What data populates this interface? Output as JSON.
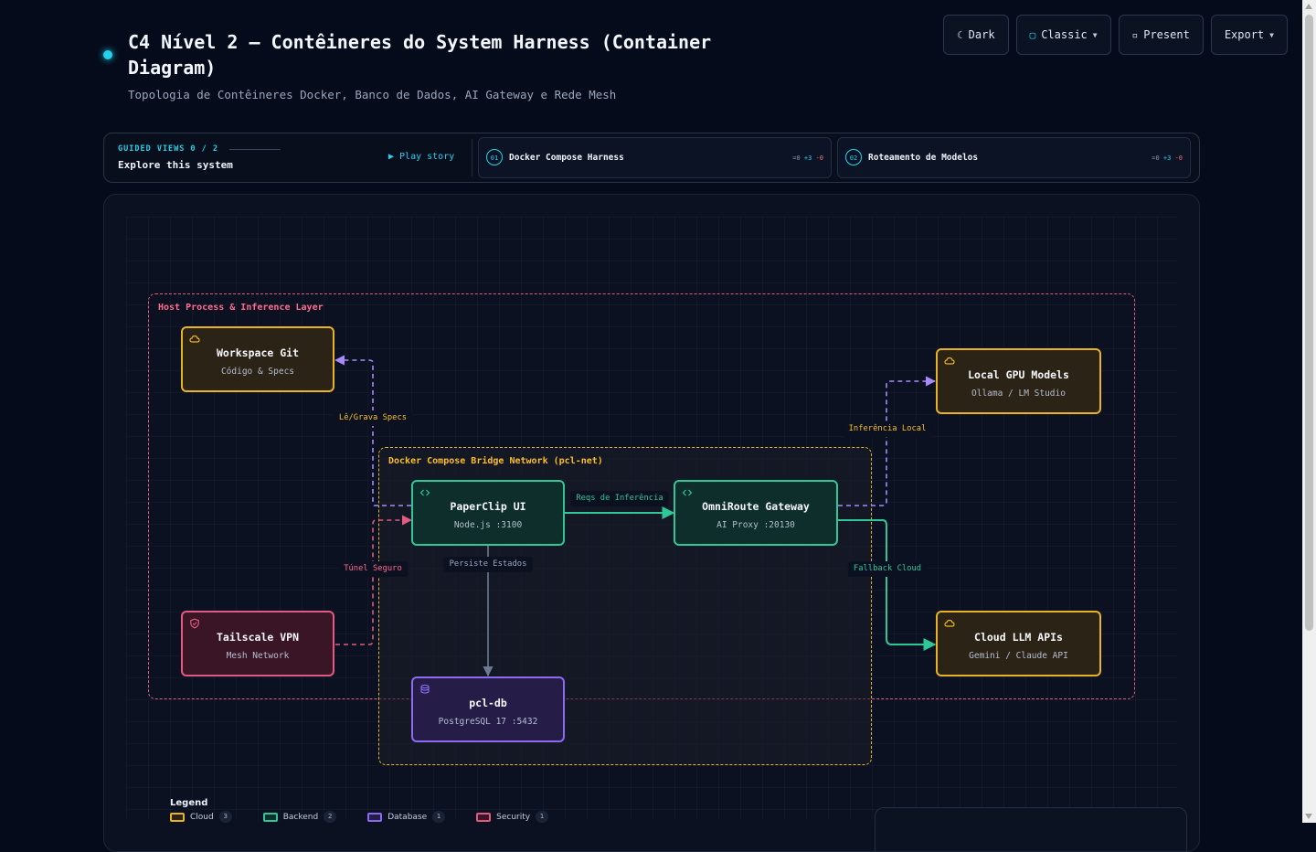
{
  "header": {
    "title": "C4 Nível 2 — Contêineres do System Harness (Container Diagram)",
    "subtitle": "Topologia de Contêineres Docker, Banco de Dados, AI Gateway e Rede Mesh"
  },
  "toolbar": {
    "theme": {
      "icon": "moon-icon",
      "label": "Dark"
    },
    "style": {
      "icon": "square-icon",
      "label": "Classic"
    },
    "present": {
      "icon": "square-outline-icon",
      "label": "Present"
    },
    "export": {
      "label": "Export"
    }
  },
  "guided_views": {
    "heading": "GUIDED VIEWS",
    "progress": "0 / 2",
    "subtitle": "Explore this system",
    "play_label": "▶ Play story",
    "views": [
      {
        "num": "01",
        "title": "Docker Compose Harness",
        "stats": [
          "=0",
          "+3",
          "-0"
        ]
      },
      {
        "num": "02",
        "title": "Roteamento de Modelos",
        "stats": [
          "=0",
          "+3",
          "-0"
        ]
      }
    ]
  },
  "diagram": {
    "boundaries": {
      "host": "Host Process & Inference Layer",
      "docker": "Docker Compose Bridge Network (pcl-net)"
    },
    "nodes": {
      "workspace": {
        "title": "Workspace Git",
        "subtitle": "Código & Specs",
        "kind": "cloud",
        "icon": "cloud-icon"
      },
      "paperclip": {
        "title": "PaperClip UI",
        "subtitle": "Node.js :3100",
        "kind": "backend",
        "icon": "code-icon"
      },
      "omniroute": {
        "title": "OmniRoute Gateway",
        "subtitle": "AI Proxy :20130",
        "kind": "backend",
        "icon": "code-icon"
      },
      "localgpu": {
        "title": "Local GPU Models",
        "subtitle": "Ollama / LM Studio",
        "kind": "cloud",
        "icon": "cloud-icon"
      },
      "cloudllm": {
        "title": "Cloud LLM APIs",
        "subtitle": "Gemini / Claude API",
        "kind": "cloud",
        "icon": "cloud-icon"
      },
      "tailscale": {
        "title": "Tailscale VPN",
        "subtitle": "Mesh Network",
        "kind": "security",
        "icon": "shield-icon"
      },
      "pcldb": {
        "title": "pcl-db",
        "subtitle": "PostgreSQL 17 :5432",
        "kind": "database",
        "icon": "database-icon"
      }
    },
    "edges": [
      {
        "from": "paperclip",
        "to": "workspace",
        "label": "Lê/Grava Specs"
      },
      {
        "from": "paperclip",
        "to": "omniroute",
        "label": "Reqs de Inferência"
      },
      {
        "from": "omniroute",
        "to": "localgpu",
        "label": "Inferência Local"
      },
      {
        "from": "omniroute",
        "to": "cloudllm",
        "label": "Fallback Cloud"
      },
      {
        "from": "paperclip",
        "to": "pcldb",
        "label": "Persiste Estados"
      },
      {
        "from": "tailscale",
        "to": "paperclip",
        "label": "Túnel Seguro"
      }
    ]
  },
  "legend": {
    "title": "Legend",
    "items": [
      {
        "label": "Cloud",
        "count": "3"
      },
      {
        "label": "Backend",
        "count": "2"
      },
      {
        "label": "Database",
        "count": "1"
      },
      {
        "label": "Security",
        "count": "1"
      }
    ]
  },
  "colors": {
    "cloud": "#e9b422",
    "backend": "#2fc797",
    "database": "#8b6cf0",
    "security": "#e15b7e",
    "read_write": "#a78bfa",
    "persist": "#6b7a90",
    "accent": "#22d3ee"
  }
}
